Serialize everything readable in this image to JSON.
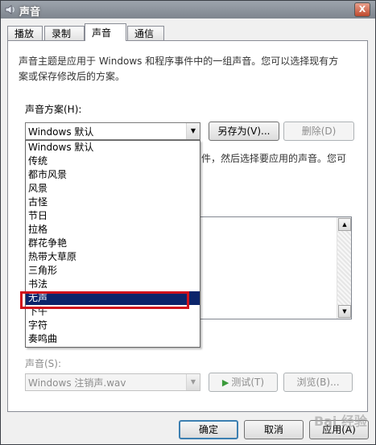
{
  "window": {
    "title": "声音",
    "close_symbol": "X"
  },
  "tabs": [
    "播放",
    "录制",
    "声音",
    "通信"
  ],
  "active_tab": 2,
  "description": [
    "声音主题是应用于 Windows 和程序事件中的一组声音。您可以选择现有方",
    "案或保存修改后的方案。"
  ],
  "scheme": {
    "label": "声音方案(H):",
    "selected": "Windows 默认",
    "save_as": "另存为(V)...",
    "delete": "删除(D)"
  },
  "events_desc_partial": "件，然后选择要应用的声音。您可",
  "dropdown_options": [
    "Windows 默认",
    "传统",
    "都市风景",
    "风景",
    "古怪",
    "节日",
    "拉格",
    "群花争艳",
    "热带大草原",
    "三角形",
    "书法",
    "无声",
    "下午",
    "字符",
    "奏鸣曲"
  ],
  "dropdown_selected_index": 11,
  "sound": {
    "label": "声音(S):",
    "value": "Windows 注销声.wav",
    "test": "测试(T)",
    "browse": "浏览(B)..."
  },
  "footer": {
    "ok": "确定",
    "cancel": "取消",
    "apply": "应用(A)"
  },
  "watermark": "Bai 经验"
}
